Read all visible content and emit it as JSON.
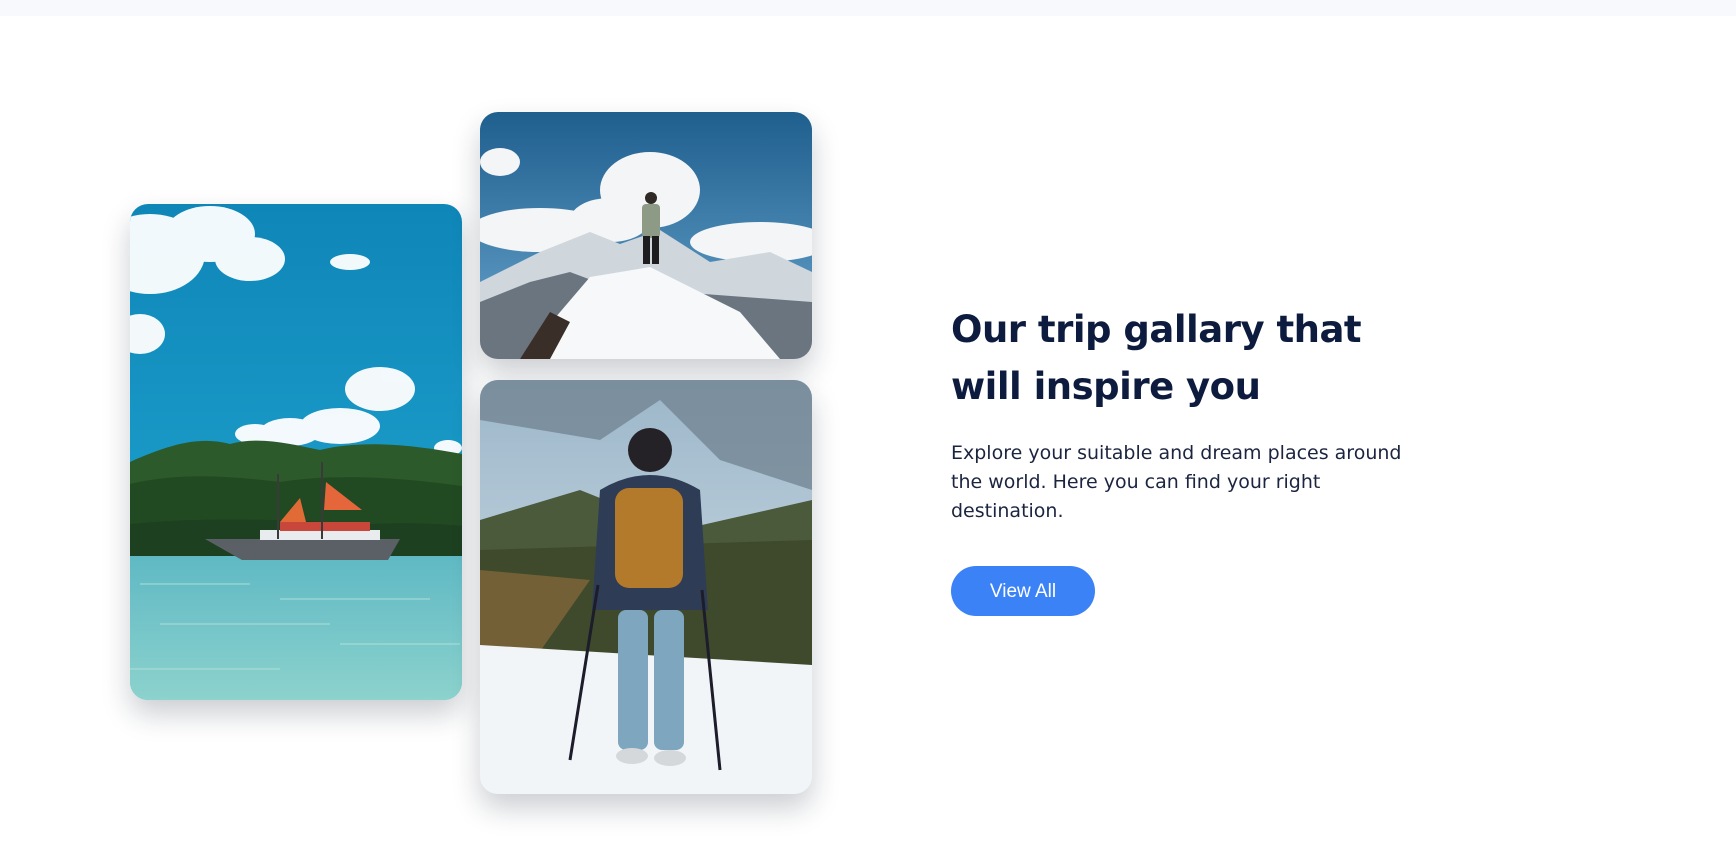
{
  "gallery": {
    "images": [
      {
        "name": "boat-lagoon-photo",
        "subject": "sailing ship on tropical bay"
      },
      {
        "name": "mountain-summit-photo",
        "subject": "hiker standing on snowy summit"
      },
      {
        "name": "snow-hiker-photo",
        "subject": "hiker with backpack and trekking poles in snow"
      }
    ]
  },
  "content": {
    "title": "Our trip gallary that will inspire you",
    "description": "Explore your suitable and dream places around the world. Here you can find your right destination.",
    "button_label": "View All"
  },
  "colors": {
    "title": "#0d1b3e",
    "text": "#1c2540",
    "button": "#3b82f6",
    "button_text": "#ffffff",
    "background": "#ffffff"
  }
}
